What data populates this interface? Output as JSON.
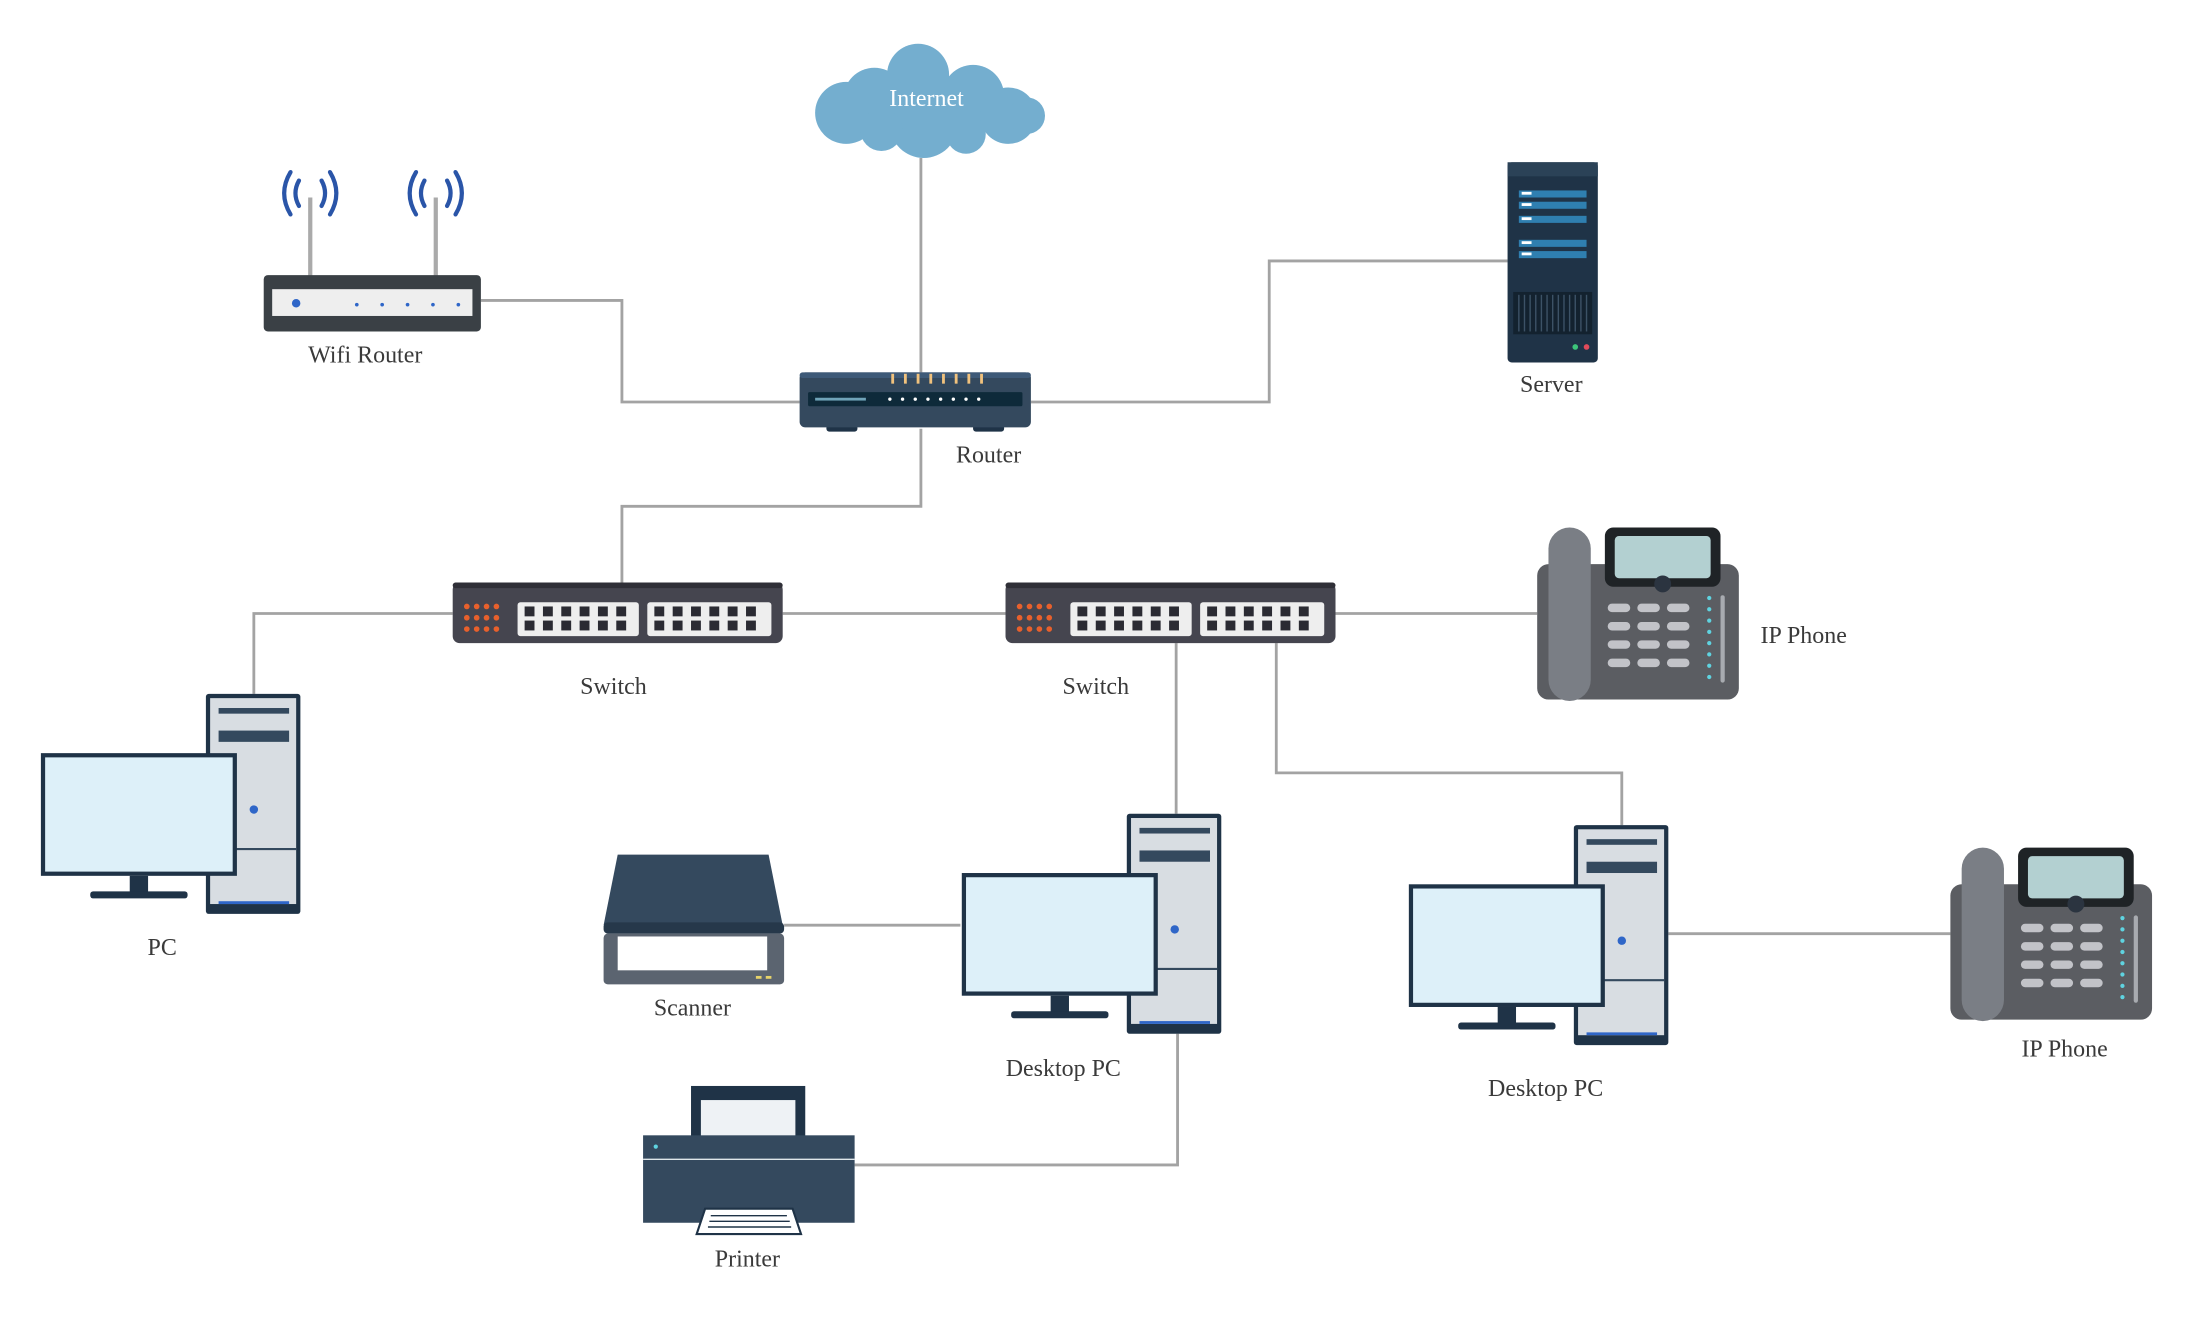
{
  "diagram": {
    "nodes": {
      "internet": {
        "label": "Internet",
        "icon": "cloud-icon"
      },
      "wifi_router": {
        "label": "Wifi Router",
        "icon": "wifi-router-icon"
      },
      "router": {
        "label": "Router",
        "icon": "router-icon"
      },
      "server": {
        "label": "Server",
        "icon": "server-icon"
      },
      "switch_1": {
        "label": "Switch",
        "icon": "switch-icon"
      },
      "switch_2": {
        "label": "Switch",
        "icon": "switch-icon"
      },
      "ip_phone_1": {
        "label": "IP Phone",
        "icon": "ip-phone-icon"
      },
      "ip_phone_2": {
        "label": "IP Phone",
        "icon": "ip-phone-icon"
      },
      "pc": {
        "label": "PC",
        "icon": "desktop-computer-icon"
      },
      "desktop_pc_1": {
        "label": "Desktop PC",
        "icon": "desktop-computer-icon"
      },
      "desktop_pc_2": {
        "label": "Desktop PC",
        "icon": "desktop-computer-icon"
      },
      "scanner": {
        "label": "Scanner",
        "icon": "scanner-icon"
      },
      "printer": {
        "label": "Printer",
        "icon": "printer-icon"
      }
    },
    "edges": [
      [
        "internet",
        "router"
      ],
      [
        "wifi_router",
        "router"
      ],
      [
        "router",
        "server"
      ],
      [
        "router",
        "switch_1"
      ],
      [
        "switch_1",
        "pc"
      ],
      [
        "switch_1",
        "switch_2"
      ],
      [
        "switch_2",
        "ip_phone_1"
      ],
      [
        "switch_2",
        "desktop_pc_1"
      ],
      [
        "switch_2",
        "desktop_pc_2"
      ],
      [
        "desktop_pc_2",
        "ip_phone_2"
      ],
      [
        "scanner",
        "desktop_pc_1"
      ],
      [
        "desktop_pc_1",
        "printer"
      ]
    ],
    "colors": {
      "line": "#a3a3a3",
      "cloud": "#74aecf",
      "device_dark": "#34495e",
      "screen": "#ddf0f9",
      "accent_blue": "#2f66c8",
      "port_orange": "#e8602c"
    }
  }
}
